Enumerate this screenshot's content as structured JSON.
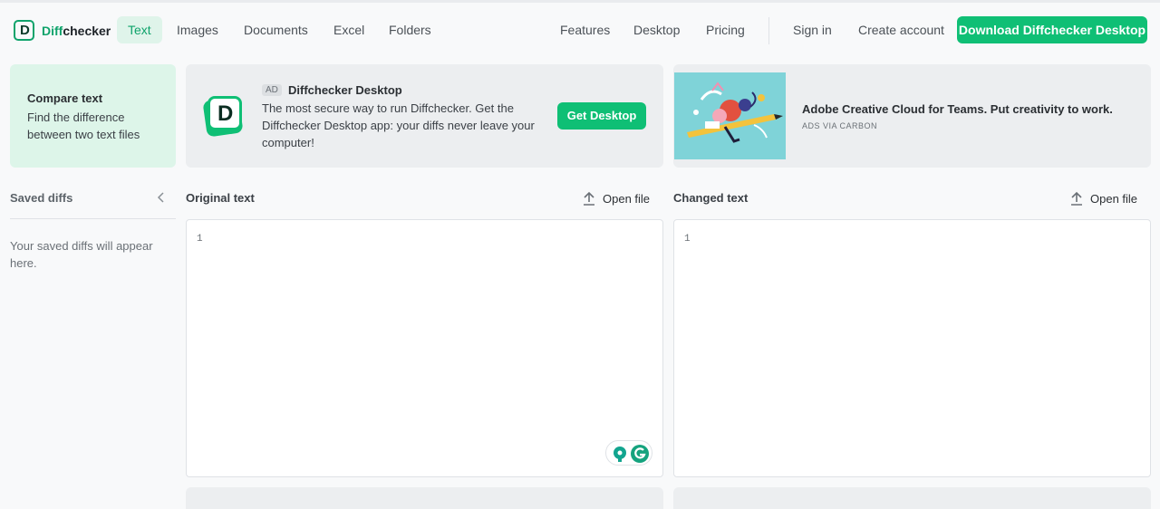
{
  "nav": {
    "logo_part1": "Diff",
    "logo_part2": "checker",
    "logo_letter": "D",
    "items": {
      "text": "Text",
      "images": "Images",
      "documents": "Documents",
      "excel": "Excel",
      "folders": "Folders",
      "features": "Features",
      "desktop": "Desktop",
      "pricing": "Pricing",
      "sign_in": "Sign in",
      "create_account": "Create account"
    },
    "download_button": "Download Diffchecker Desktop"
  },
  "compare_card": {
    "title": "Compare text",
    "description": "Find the difference between two text files"
  },
  "ad": {
    "tag": "AD",
    "logo_letter": "D",
    "title": "Diffchecker Desktop",
    "description": "The most secure way to run Diffchecker. Get the Diffchecker Desktop app: your diffs never leave your computer!",
    "button": "Get Desktop"
  },
  "carbon": {
    "text": "Adobe Creative Cloud for Teams. Put creativity to work.",
    "sub": "ADS VIA CARBON"
  },
  "sidebar": {
    "title": "Saved diffs",
    "empty_text": "Your saved diffs will appear here."
  },
  "original": {
    "label": "Original text",
    "open_file": "Open file",
    "line_number": "1"
  },
  "changed": {
    "label": "Changed text",
    "open_file": "Open file",
    "line_number": "1"
  },
  "colors": {
    "accent": "#0fbf75",
    "accent_dark": "#0fa36b",
    "active_tab_bg": "#dff4ea"
  }
}
